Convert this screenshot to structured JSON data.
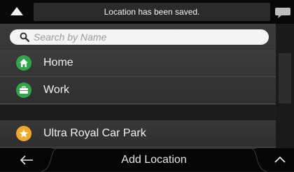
{
  "notification": {
    "text": "Location has been saved."
  },
  "search": {
    "placeholder": "Search by Name"
  },
  "locations": [
    {
      "label": "Home",
      "icon": "home-icon",
      "color": "#2fa64a"
    },
    {
      "label": "Work",
      "icon": "briefcase-icon",
      "color": "#2fa64a"
    },
    {
      "label": "Ultra Royal Car Park",
      "icon": "star-icon",
      "color": "#f0a92b"
    }
  ],
  "bottom_bar": {
    "add_location_label": "Add Location"
  }
}
